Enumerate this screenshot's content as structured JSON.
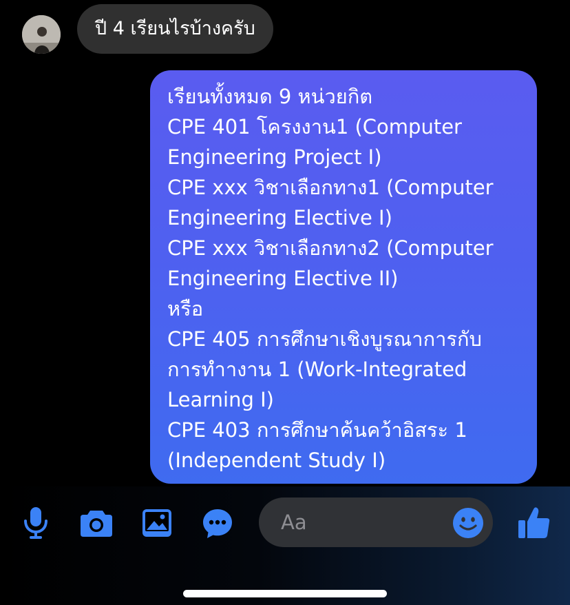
{
  "conversation": {
    "incoming_message": "ปี 4 เรียนไรบ้างครับ",
    "outgoing_lines": [
      "เรียนทั้งหมด 9 หน่วยกิต",
      "CPE 401 โครงงาน1 (Computer",
      "Engineering Project I)",
      "CPE xxx วิชาเลือกทาง1 (Computer",
      "Engineering Elective I)",
      "CPE xxx วิชาเลือกทาง2 (Computer",
      "Engineering Elective II)",
      "หรือ",
      "CPE 405 การศึกษาเชิงบูรณาการกับ",
      "การทำางาน 1 (Work-Integrated",
      "Learning I)",
      "CPE 403 การศึกษาค้นคว้าอิสระ 1",
      "(Independent Study I)"
    ]
  },
  "composer": {
    "placeholder": "Aa",
    "icons": [
      "microphone-icon",
      "camera-icon",
      "image-icon",
      "chat-bubble-icon",
      "smiley-icon",
      "thumbs-up-icon"
    ],
    "accent_color": "#3b82f6"
  },
  "colors": {
    "background": "#000000",
    "incoming_bubble": "#303030",
    "outgoing_gradient_top": "#5a5cf0",
    "outgoing_gradient_bottom": "#3f6bf0"
  }
}
